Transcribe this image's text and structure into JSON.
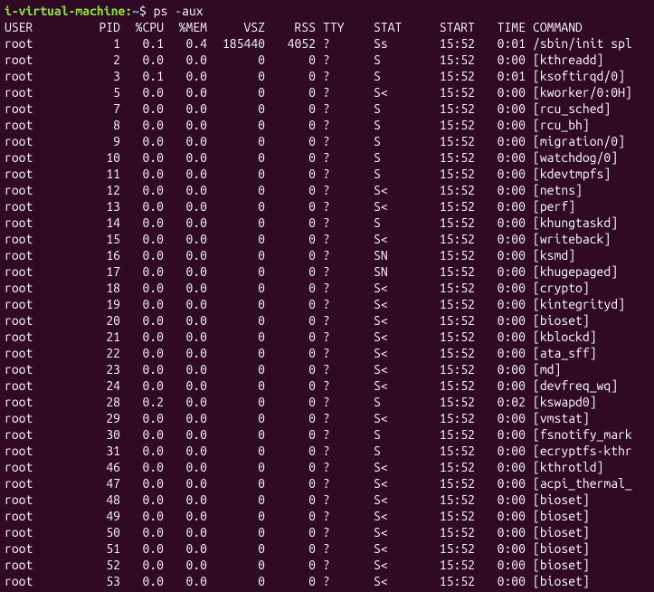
{
  "prompt": {
    "user_host": "i-virtual-machine",
    "path": "~",
    "separator": "$",
    "command": "ps -aux"
  },
  "headers": {
    "user": "USER",
    "pid": "PID",
    "cpu": "%CPU",
    "mem": "%MEM",
    "vsz": "VSZ",
    "rss": "RSS",
    "tty": "TTY",
    "stat": "STAT",
    "start": "START",
    "time": "TIME",
    "command": "COMMAND"
  },
  "rows": [
    {
      "user": "root",
      "pid": "1",
      "cpu": "0.1",
      "mem": "0.4",
      "vsz": "185440",
      "rss": "4052",
      "tty": "?",
      "stat": "Ss",
      "start": "15:52",
      "time": "0:01",
      "command": "/sbin/init spl"
    },
    {
      "user": "root",
      "pid": "2",
      "cpu": "0.0",
      "mem": "0.0",
      "vsz": "0",
      "rss": "0",
      "tty": "?",
      "stat": "S",
      "start": "15:52",
      "time": "0:00",
      "command": "[kthreadd]"
    },
    {
      "user": "root",
      "pid": "3",
      "cpu": "0.1",
      "mem": "0.0",
      "vsz": "0",
      "rss": "0",
      "tty": "?",
      "stat": "S",
      "start": "15:52",
      "time": "0:01",
      "command": "[ksoftirqd/0]"
    },
    {
      "user": "root",
      "pid": "5",
      "cpu": "0.0",
      "mem": "0.0",
      "vsz": "0",
      "rss": "0",
      "tty": "?",
      "stat": "S<",
      "start": "15:52",
      "time": "0:00",
      "command": "[kworker/0:0H]"
    },
    {
      "user": "root",
      "pid": "7",
      "cpu": "0.0",
      "mem": "0.0",
      "vsz": "0",
      "rss": "0",
      "tty": "?",
      "stat": "S",
      "start": "15:52",
      "time": "0:00",
      "command": "[rcu_sched]"
    },
    {
      "user": "root",
      "pid": "8",
      "cpu": "0.0",
      "mem": "0.0",
      "vsz": "0",
      "rss": "0",
      "tty": "?",
      "stat": "S",
      "start": "15:52",
      "time": "0:00",
      "command": "[rcu_bh]"
    },
    {
      "user": "root",
      "pid": "9",
      "cpu": "0.0",
      "mem": "0.0",
      "vsz": "0",
      "rss": "0",
      "tty": "?",
      "stat": "S",
      "start": "15:52",
      "time": "0:00",
      "command": "[migration/0]"
    },
    {
      "user": "root",
      "pid": "10",
      "cpu": "0.0",
      "mem": "0.0",
      "vsz": "0",
      "rss": "0",
      "tty": "?",
      "stat": "S",
      "start": "15:52",
      "time": "0:00",
      "command": "[watchdog/0]"
    },
    {
      "user": "root",
      "pid": "11",
      "cpu": "0.0",
      "mem": "0.0",
      "vsz": "0",
      "rss": "0",
      "tty": "?",
      "stat": "S",
      "start": "15:52",
      "time": "0:00",
      "command": "[kdevtmpfs]"
    },
    {
      "user": "root",
      "pid": "12",
      "cpu": "0.0",
      "mem": "0.0",
      "vsz": "0",
      "rss": "0",
      "tty": "?",
      "stat": "S<",
      "start": "15:52",
      "time": "0:00",
      "command": "[netns]"
    },
    {
      "user": "root",
      "pid": "13",
      "cpu": "0.0",
      "mem": "0.0",
      "vsz": "0",
      "rss": "0",
      "tty": "?",
      "stat": "S<",
      "start": "15:52",
      "time": "0:00",
      "command": "[perf]"
    },
    {
      "user": "root",
      "pid": "14",
      "cpu": "0.0",
      "mem": "0.0",
      "vsz": "0",
      "rss": "0",
      "tty": "?",
      "stat": "S",
      "start": "15:52",
      "time": "0:00",
      "command": "[khungtaskd]"
    },
    {
      "user": "root",
      "pid": "15",
      "cpu": "0.0",
      "mem": "0.0",
      "vsz": "0",
      "rss": "0",
      "tty": "?",
      "stat": "S<",
      "start": "15:52",
      "time": "0:00",
      "command": "[writeback]"
    },
    {
      "user": "root",
      "pid": "16",
      "cpu": "0.0",
      "mem": "0.0",
      "vsz": "0",
      "rss": "0",
      "tty": "?",
      "stat": "SN",
      "start": "15:52",
      "time": "0:00",
      "command": "[ksmd]"
    },
    {
      "user": "root",
      "pid": "17",
      "cpu": "0.0",
      "mem": "0.0",
      "vsz": "0",
      "rss": "0",
      "tty": "?",
      "stat": "SN",
      "start": "15:52",
      "time": "0:00",
      "command": "[khugepaged]"
    },
    {
      "user": "root",
      "pid": "18",
      "cpu": "0.0",
      "mem": "0.0",
      "vsz": "0",
      "rss": "0",
      "tty": "?",
      "stat": "S<",
      "start": "15:52",
      "time": "0:00",
      "command": "[crypto]"
    },
    {
      "user": "root",
      "pid": "19",
      "cpu": "0.0",
      "mem": "0.0",
      "vsz": "0",
      "rss": "0",
      "tty": "?",
      "stat": "S<",
      "start": "15:52",
      "time": "0:00",
      "command": "[kintegrityd]"
    },
    {
      "user": "root",
      "pid": "20",
      "cpu": "0.0",
      "mem": "0.0",
      "vsz": "0",
      "rss": "0",
      "tty": "?",
      "stat": "S<",
      "start": "15:52",
      "time": "0:00",
      "command": "[bioset]"
    },
    {
      "user": "root",
      "pid": "21",
      "cpu": "0.0",
      "mem": "0.0",
      "vsz": "0",
      "rss": "0",
      "tty": "?",
      "stat": "S<",
      "start": "15:52",
      "time": "0:00",
      "command": "[kblockd]"
    },
    {
      "user": "root",
      "pid": "22",
      "cpu": "0.0",
      "mem": "0.0",
      "vsz": "0",
      "rss": "0",
      "tty": "?",
      "stat": "S<",
      "start": "15:52",
      "time": "0:00",
      "command": "[ata_sff]"
    },
    {
      "user": "root",
      "pid": "23",
      "cpu": "0.0",
      "mem": "0.0",
      "vsz": "0",
      "rss": "0",
      "tty": "?",
      "stat": "S<",
      "start": "15:52",
      "time": "0:00",
      "command": "[md]"
    },
    {
      "user": "root",
      "pid": "24",
      "cpu": "0.0",
      "mem": "0.0",
      "vsz": "0",
      "rss": "0",
      "tty": "?",
      "stat": "S<",
      "start": "15:52",
      "time": "0:00",
      "command": "[devfreq_wq]"
    },
    {
      "user": "root",
      "pid": "28",
      "cpu": "0.2",
      "mem": "0.0",
      "vsz": "0",
      "rss": "0",
      "tty": "?",
      "stat": "S",
      "start": "15:52",
      "time": "0:02",
      "command": "[kswapd0]"
    },
    {
      "user": "root",
      "pid": "29",
      "cpu": "0.0",
      "mem": "0.0",
      "vsz": "0",
      "rss": "0",
      "tty": "?",
      "stat": "S<",
      "start": "15:52",
      "time": "0:00",
      "command": "[vmstat]"
    },
    {
      "user": "root",
      "pid": "30",
      "cpu": "0.0",
      "mem": "0.0",
      "vsz": "0",
      "rss": "0",
      "tty": "?",
      "stat": "S",
      "start": "15:52",
      "time": "0:00",
      "command": "[fsnotify_mark"
    },
    {
      "user": "root",
      "pid": "31",
      "cpu": "0.0",
      "mem": "0.0",
      "vsz": "0",
      "rss": "0",
      "tty": "?",
      "stat": "S",
      "start": "15:52",
      "time": "0:00",
      "command": "[ecryptfs-kthr"
    },
    {
      "user": "root",
      "pid": "46",
      "cpu": "0.0",
      "mem": "0.0",
      "vsz": "0",
      "rss": "0",
      "tty": "?",
      "stat": "S<",
      "start": "15:52",
      "time": "0:00",
      "command": "[kthrotld]"
    },
    {
      "user": "root",
      "pid": "47",
      "cpu": "0.0",
      "mem": "0.0",
      "vsz": "0",
      "rss": "0",
      "tty": "?",
      "stat": "S<",
      "start": "15:52",
      "time": "0:00",
      "command": "[acpi_thermal_"
    },
    {
      "user": "root",
      "pid": "48",
      "cpu": "0.0",
      "mem": "0.0",
      "vsz": "0",
      "rss": "0",
      "tty": "?",
      "stat": "S<",
      "start": "15:52",
      "time": "0:00",
      "command": "[bioset]"
    },
    {
      "user": "root",
      "pid": "49",
      "cpu": "0.0",
      "mem": "0.0",
      "vsz": "0",
      "rss": "0",
      "tty": "?",
      "stat": "S<",
      "start": "15:52",
      "time": "0:00",
      "command": "[bioset]"
    },
    {
      "user": "root",
      "pid": "50",
      "cpu": "0.0",
      "mem": "0.0",
      "vsz": "0",
      "rss": "0",
      "tty": "?",
      "stat": "S<",
      "start": "15:52",
      "time": "0:00",
      "command": "[bioset]"
    },
    {
      "user": "root",
      "pid": "51",
      "cpu": "0.0",
      "mem": "0.0",
      "vsz": "0",
      "rss": "0",
      "tty": "?",
      "stat": "S<",
      "start": "15:52",
      "time": "0:00",
      "command": "[bioset]"
    },
    {
      "user": "root",
      "pid": "52",
      "cpu": "0.0",
      "mem": "0.0",
      "vsz": "0",
      "rss": "0",
      "tty": "?",
      "stat": "S<",
      "start": "15:52",
      "time": "0:00",
      "command": "[bioset]"
    },
    {
      "user": "root",
      "pid": "53",
      "cpu": "0.0",
      "mem": "0.0",
      "vsz": "0",
      "rss": "0",
      "tty": "?",
      "stat": "S<",
      "start": "15:52",
      "time": "0:00",
      "command": "[bioset]"
    }
  ]
}
